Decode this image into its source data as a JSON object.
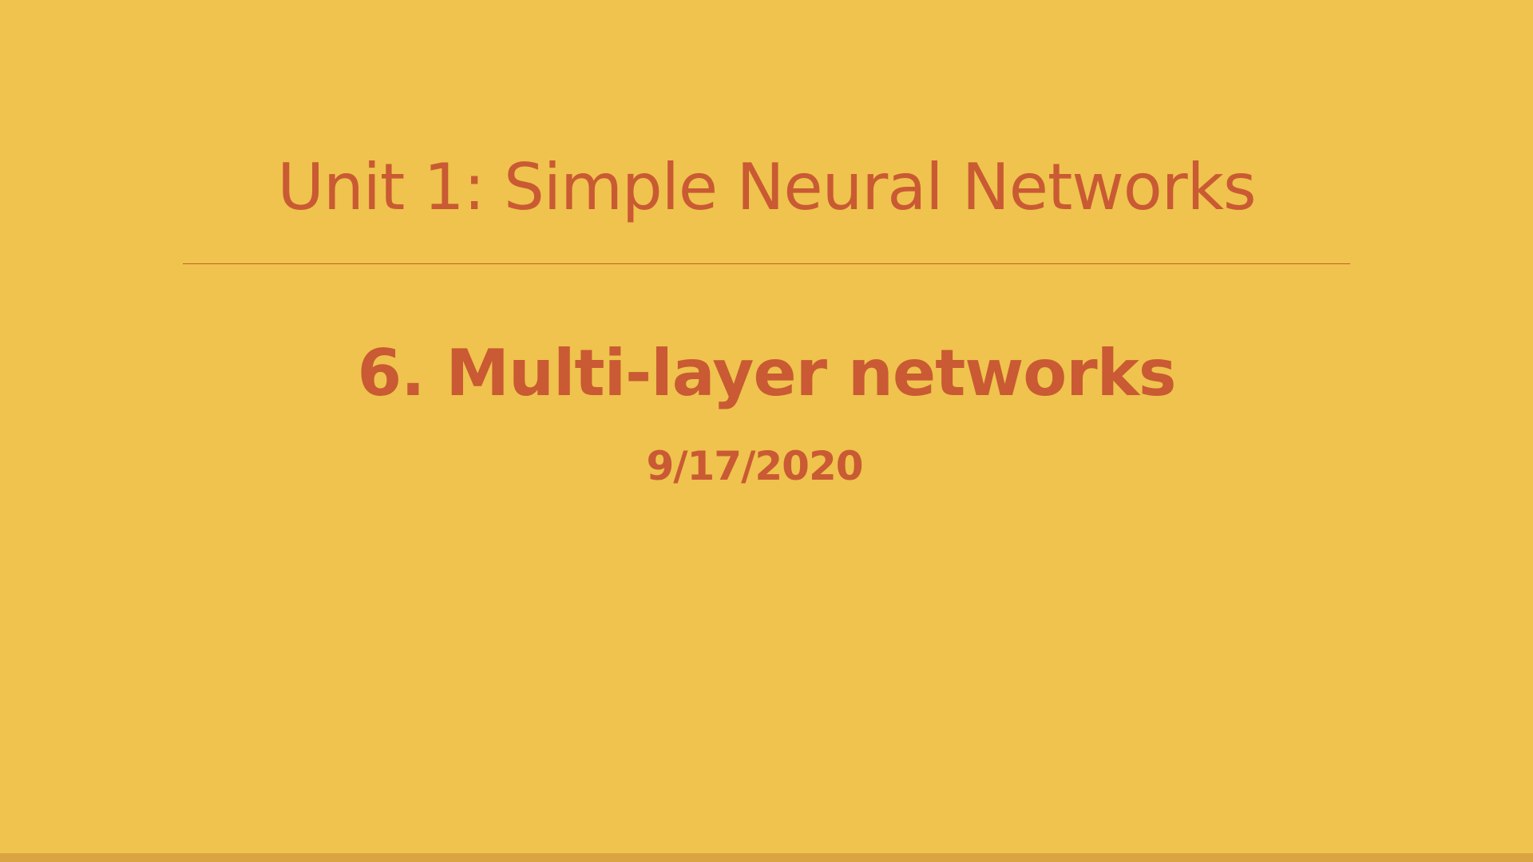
{
  "slide": {
    "unit_title": "Unit 1: Simple Neural Networks",
    "lesson_title": "6. Multi-layer networks",
    "date": "9/17/2020"
  },
  "colors": {
    "background": "#EFC34D",
    "text": "#C95A33",
    "bottom_bar": "#D9A441"
  }
}
